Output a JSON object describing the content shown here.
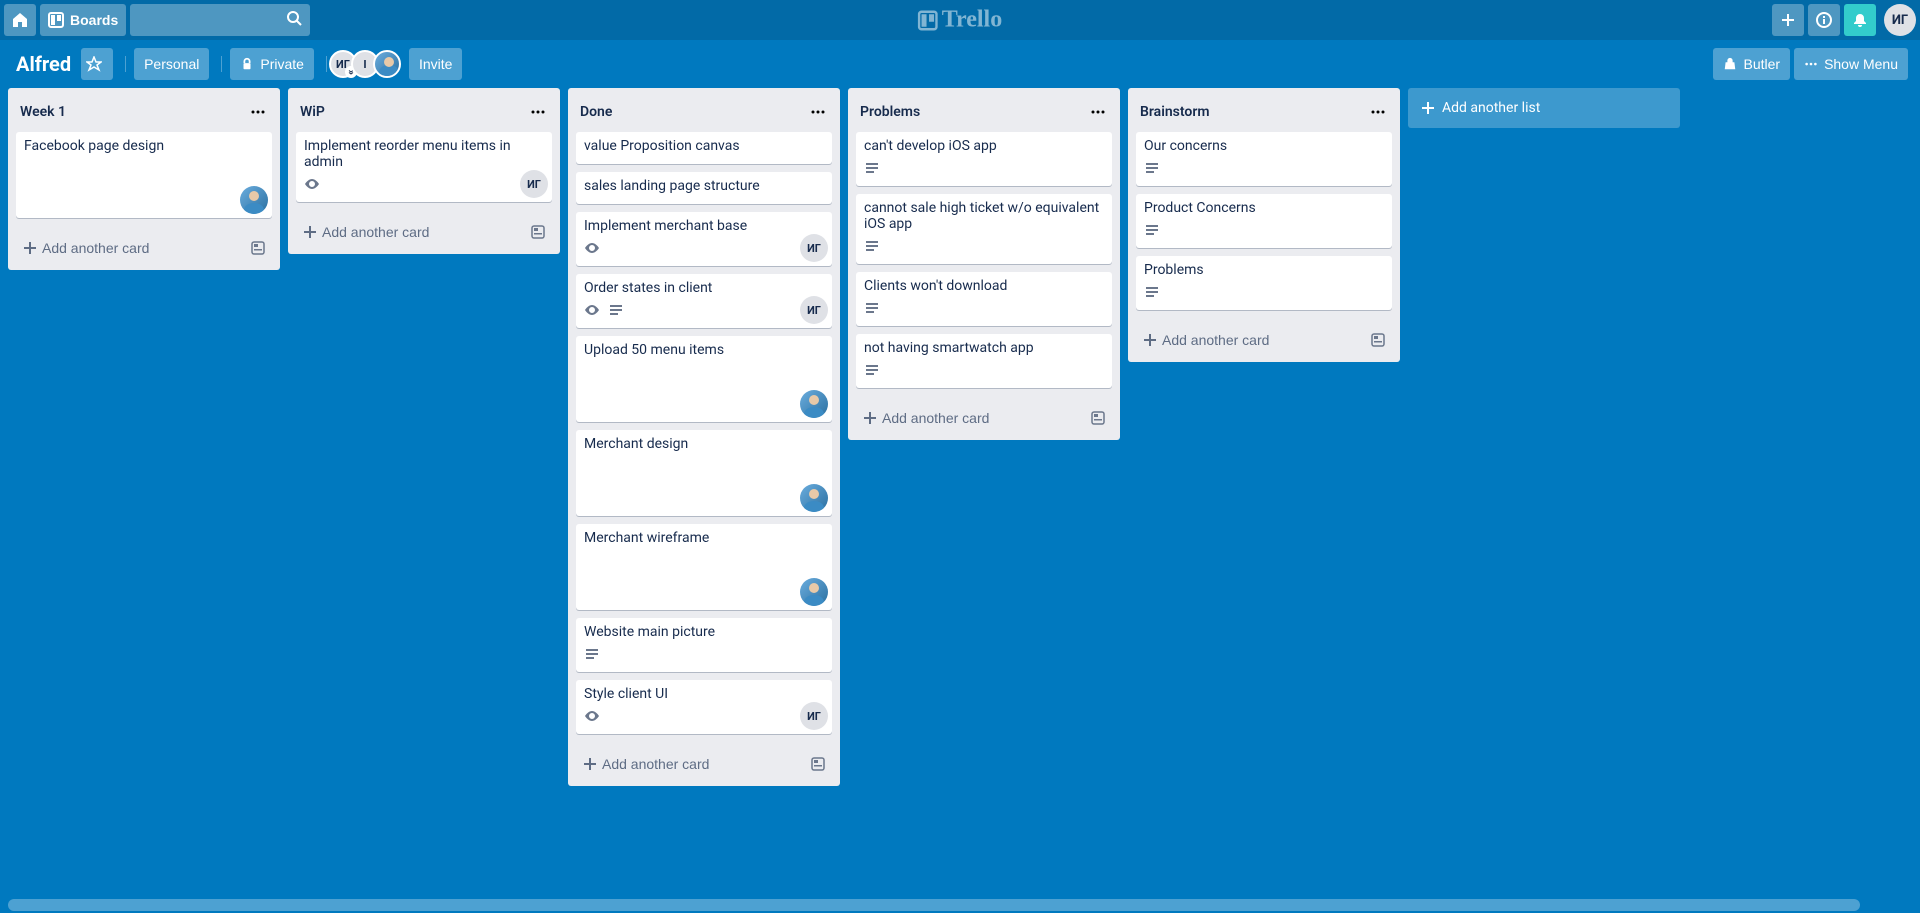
{
  "header": {
    "boards_label": "Boards",
    "logo_text": "Trello",
    "user_initials": "ИГ",
    "search_placeholder": ""
  },
  "board": {
    "title": "Alfred",
    "visibility_team": "Personal",
    "visibility_privacy": "Private",
    "invite_label": "Invite",
    "butler_label": "Butler",
    "show_menu_label": "Show Menu",
    "add_list_label": "Add another list",
    "members": [
      {
        "type": "initials",
        "text": "ИГ",
        "chevrons": true
      },
      {
        "type": "initials",
        "text": "I"
      },
      {
        "type": "photo"
      }
    ]
  },
  "lists": [
    {
      "title": "Week 1",
      "add_card_label": "Add another card",
      "cards": [
        {
          "title": "Facebook page design",
          "watch": false,
          "desc": false,
          "members": [
            {
              "type": "photo"
            }
          ]
        }
      ]
    },
    {
      "title": "WiP",
      "add_card_label": "Add another card",
      "cards": [
        {
          "title": "Implement reorder menu items in admin",
          "watch": true,
          "desc": false,
          "members": [
            {
              "type": "initials",
              "text": "ИГ"
            }
          ]
        }
      ]
    },
    {
      "title": "Done",
      "add_card_label": "Add another card",
      "cards": [
        {
          "title": "value Proposition canvas",
          "watch": false,
          "desc": false,
          "members": []
        },
        {
          "title": "sales landing page structure",
          "watch": false,
          "desc": false,
          "members": []
        },
        {
          "title": "Implement merchant base",
          "watch": true,
          "desc": false,
          "members": [
            {
              "type": "initials",
              "text": "ИГ"
            }
          ]
        },
        {
          "title": "Order states in client",
          "watch": true,
          "desc": true,
          "members": [
            {
              "type": "initials",
              "text": "ИГ"
            }
          ]
        },
        {
          "title": "Upload 50 menu items",
          "watch": false,
          "desc": false,
          "members": [
            {
              "type": "photo"
            }
          ]
        },
        {
          "title": "Merchant design",
          "watch": false,
          "desc": false,
          "members": [
            {
              "type": "photo"
            }
          ]
        },
        {
          "title": "Merchant wireframe",
          "watch": false,
          "desc": false,
          "members": [
            {
              "type": "photo"
            }
          ]
        },
        {
          "title": "Website main picture",
          "watch": false,
          "desc": true,
          "members": []
        },
        {
          "title": "Style client UI",
          "watch": true,
          "desc": false,
          "members": [
            {
              "type": "initials",
              "text": "ИГ"
            }
          ]
        }
      ]
    },
    {
      "title": "Problems",
      "add_card_label": "Add another card",
      "cards": [
        {
          "title": "can't develop iOS app",
          "watch": false,
          "desc": true,
          "members": []
        },
        {
          "title": "cannot sale high ticket w/o equivalent iOS app",
          "watch": false,
          "desc": true,
          "members": []
        },
        {
          "title": "Clients won't download",
          "watch": false,
          "desc": true,
          "members": []
        },
        {
          "title": "not having smartwatch app",
          "watch": false,
          "desc": true,
          "members": []
        }
      ]
    },
    {
      "title": "Brainstorm",
      "add_card_label": "Add another card",
      "cards": [
        {
          "title": "Our concerns",
          "watch": false,
          "desc": true,
          "members": []
        },
        {
          "title": "Product Concerns",
          "watch": false,
          "desc": true,
          "members": []
        },
        {
          "title": "Problems",
          "watch": false,
          "desc": true,
          "members": []
        }
      ]
    }
  ]
}
